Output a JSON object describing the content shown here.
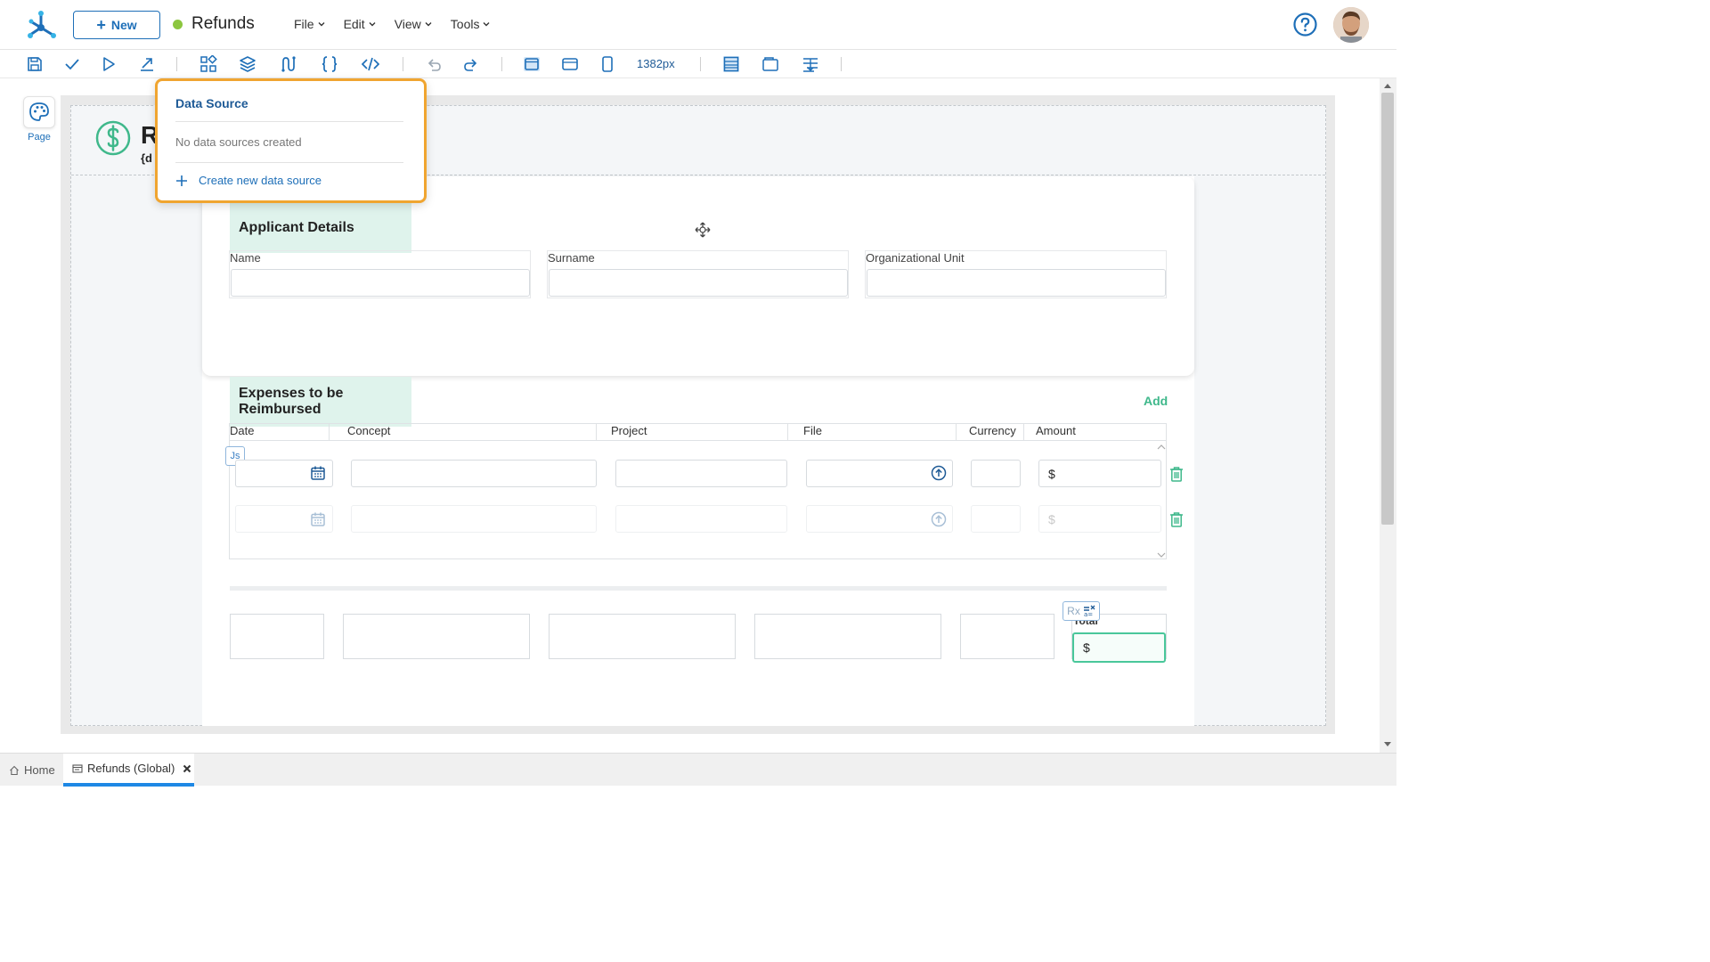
{
  "app": {
    "title": "Refunds",
    "new_label": "New"
  },
  "menu": [
    "File",
    "Edit",
    "View",
    "Tools"
  ],
  "toolbar": {
    "width_readout": "1382px"
  },
  "rail": {
    "page_label": "Page"
  },
  "page": {
    "title": "R",
    "subtitle": "{d"
  },
  "data_source_popup": {
    "title": "Data Source",
    "empty_message": "No data sources created",
    "create_label": "Create new data source"
  },
  "applicant": {
    "title": "Applicant Details",
    "fields": [
      "Name",
      "Surname",
      "Organizational Unit"
    ]
  },
  "expenses": {
    "title": "Expenses to be Reimbursed",
    "add_label": "Add",
    "columns": [
      "Date",
      "Concept",
      "Project",
      "File",
      "Currency",
      "Amount"
    ],
    "js_badge": "Js",
    "currency_symbol": "$"
  },
  "total": {
    "label": "Total",
    "value": "$",
    "rx_badge": "Rx"
  },
  "bottom_tabs": [
    {
      "label": "Home"
    },
    {
      "label": "Refunds (Global)"
    }
  ],
  "colors": {
    "primary": "#1e6fb8",
    "accent_green": "#3fb88b",
    "highlight_orange": "#f0a530",
    "section_bg": "#dff3ec"
  }
}
